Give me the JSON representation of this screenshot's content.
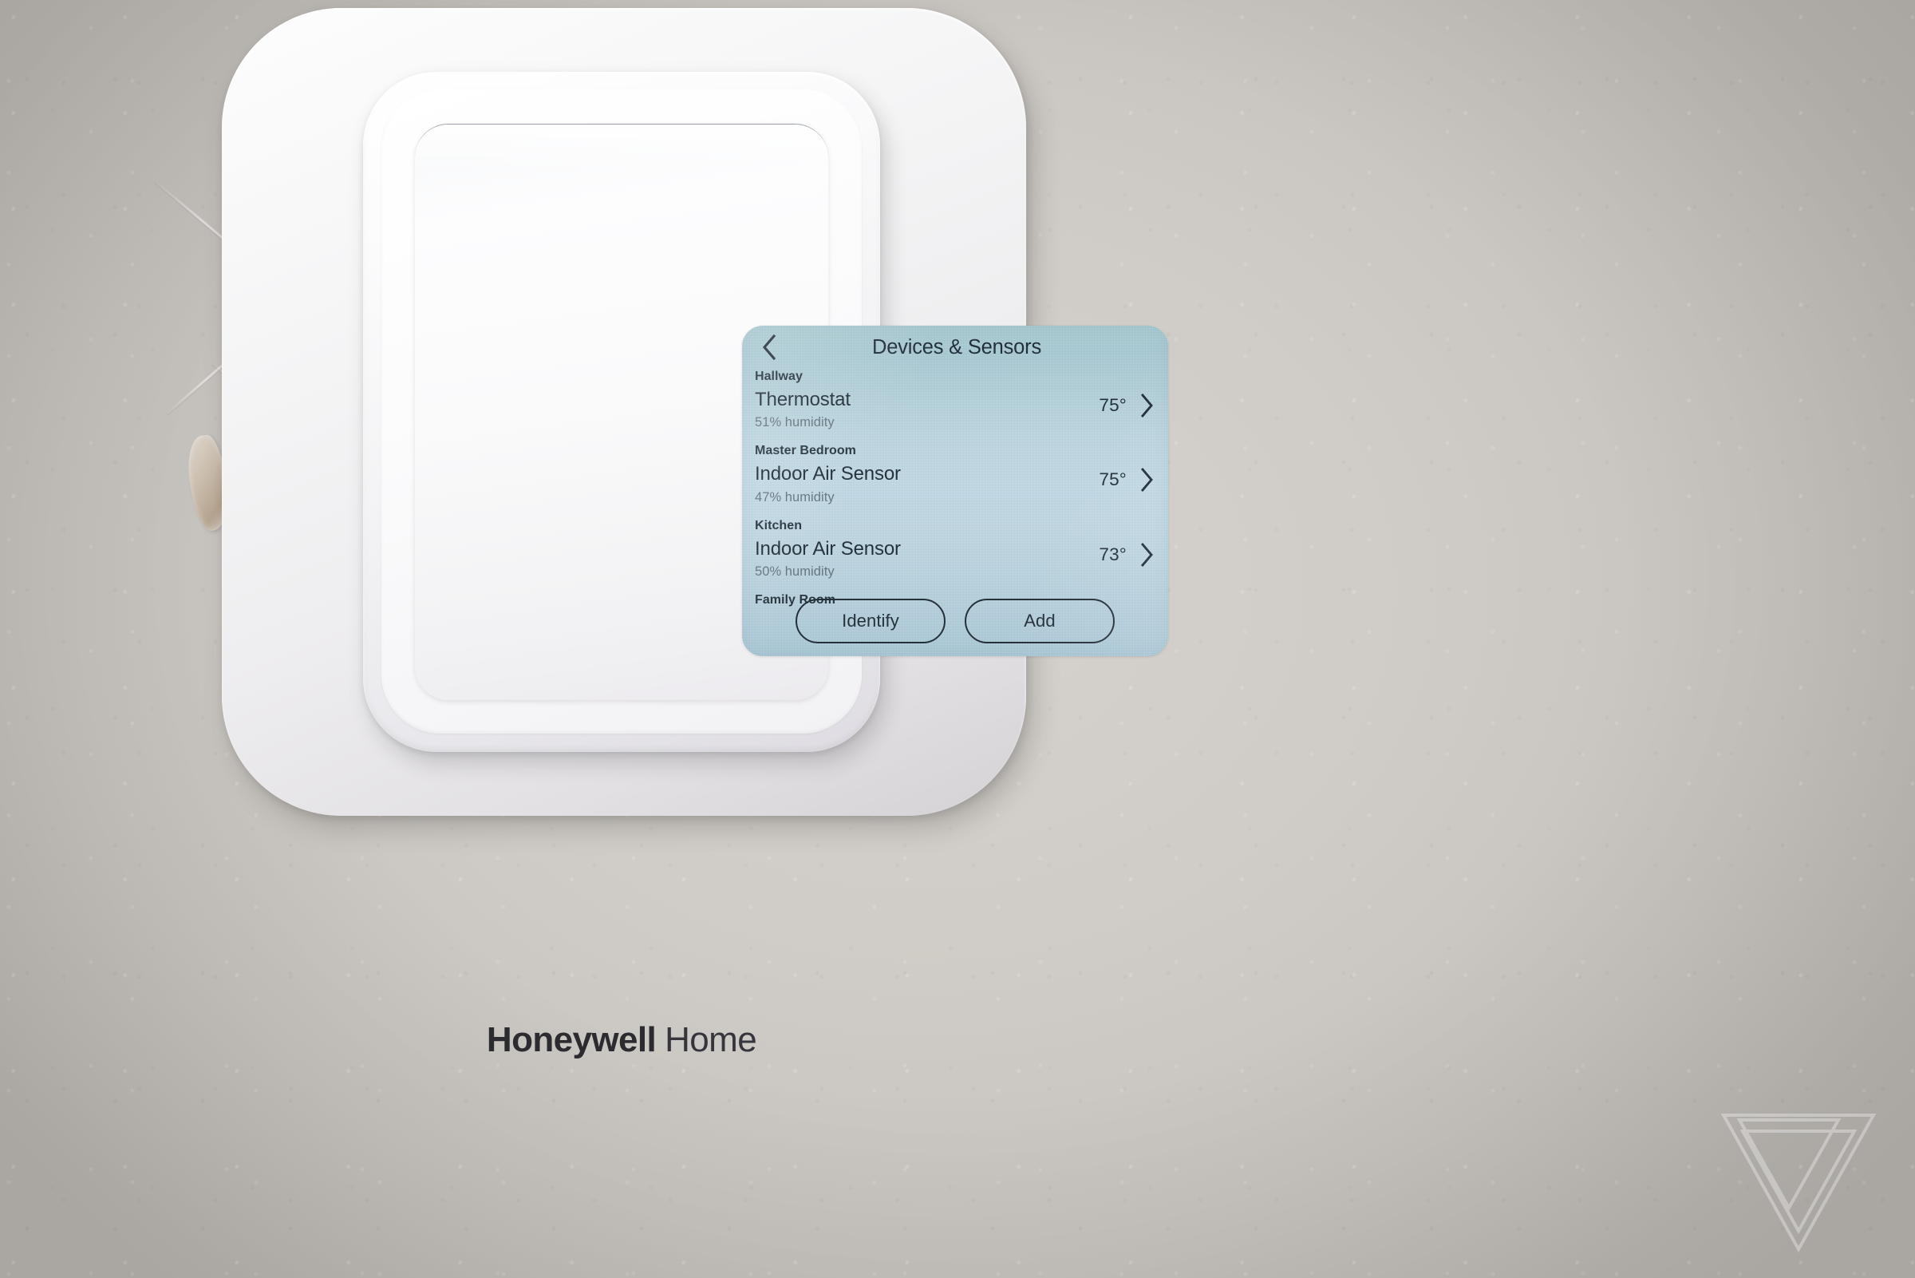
{
  "photo": {
    "subject": "Honeywell Home T9 smart thermostat mounted on wall",
    "watermark": "verge-logo"
  },
  "brand": {
    "primary": "Honeywell",
    "secondary": "Home"
  },
  "screen": {
    "header": {
      "back_icon": "chevron-left-icon",
      "title": "Devices & Sensors"
    },
    "groups": [
      {
        "label": "Hallway",
        "devices": [
          {
            "name": "Thermostat",
            "humidity": "51% humidity",
            "temperature": "75°",
            "chevron_icon": "chevron-right-icon"
          }
        ]
      },
      {
        "label": "Master Bedroom",
        "devices": [
          {
            "name": "Indoor Air Sensor",
            "humidity": "47% humidity",
            "temperature": "75°",
            "chevron_icon": "chevron-right-icon"
          }
        ]
      },
      {
        "label": "Kitchen",
        "devices": [
          {
            "name": "Indoor Air Sensor",
            "humidity": "50% humidity",
            "temperature": "73°",
            "chevron_icon": "chevron-right-icon"
          }
        ]
      },
      {
        "label": "Family Room",
        "devices": []
      }
    ],
    "footer": {
      "identify_label": "Identify",
      "add_label": "Add"
    },
    "colors": {
      "lcd_top": "#a9ccd3",
      "lcd_mid": "#c1dae6",
      "lcd_bottom": "#aac9d8",
      "text_primary": "#15252f",
      "text_secondary": "#5d6f7b"
    }
  }
}
